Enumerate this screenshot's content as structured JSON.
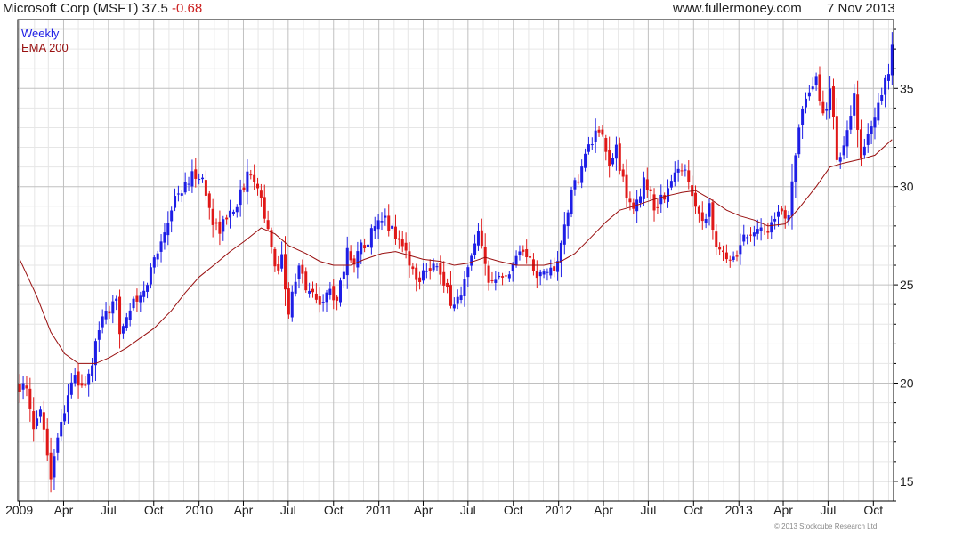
{
  "header": {
    "title": "Microsoft Corp (MSFT) 37.5",
    "change": "-0.68",
    "site": "www.fullermoney.com",
    "date": "7 Nov 2013"
  },
  "copyright": "© 2013 Stockcube Research Ltd",
  "colors": {
    "up": "#1e1ee6",
    "down": "#e01818",
    "ema": "#990f0f",
    "grid": "#c0c0c0",
    "minor_grid": "#e6e6e6"
  },
  "chart_data": {
    "type": "candlestick",
    "title": "Microsoft Corp (MSFT) 37.5 -0.68",
    "frequency": "Weekly",
    "legend": [
      {
        "name": "Weekly",
        "color": "#1e1ee6"
      },
      {
        "name": "EMA 200",
        "color": "#990f0f"
      }
    ],
    "legend_position": "top-left",
    "y_axis_position": "right",
    "ylim": [
      14,
      38.5
    ],
    "y_ticks": [
      15,
      20,
      25,
      30,
      35
    ],
    "x_range": [
      "2008-12-29",
      "2013-11-11"
    ],
    "x_ticks": [
      {
        "date": "2009-01-01",
        "label": "2009"
      },
      {
        "date": "2009-04-01",
        "label": "Apr"
      },
      {
        "date": "2009-07-01",
        "label": "Jul"
      },
      {
        "date": "2009-10-01",
        "label": "Oct"
      },
      {
        "date": "2010-01-01",
        "label": "2010"
      },
      {
        "date": "2010-04-01",
        "label": "Apr"
      },
      {
        "date": "2010-07-01",
        "label": "Jul"
      },
      {
        "date": "2010-10-01",
        "label": "Oct"
      },
      {
        "date": "2011-01-01",
        "label": "2011"
      },
      {
        "date": "2011-04-01",
        "label": "Apr"
      },
      {
        "date": "2011-07-01",
        "label": "Jul"
      },
      {
        "date": "2011-10-01",
        "label": "Oct"
      },
      {
        "date": "2012-01-01",
        "label": "2012"
      },
      {
        "date": "2012-04-01",
        "label": "Apr"
      },
      {
        "date": "2012-07-01",
        "label": "Jul"
      },
      {
        "date": "2012-10-01",
        "label": "Oct"
      },
      {
        "date": "2013-01-01",
        "label": "2013"
      },
      {
        "date": "2013-04-01",
        "label": "Apr"
      },
      {
        "date": "2013-07-01",
        "label": "Jul"
      },
      {
        "date": "2013-10-01",
        "label": "Oct"
      }
    ],
    "price_anchors": [
      [
        "2009-01-02",
        19.9
      ],
      [
        "2009-01-16",
        19.5
      ],
      [
        "2009-01-30",
        17.5
      ],
      [
        "2009-02-13",
        19.0
      ],
      [
        "2009-02-27",
        16.4
      ],
      [
        "2009-03-06",
        15.3
      ],
      [
        "2009-03-13",
        16.5
      ],
      [
        "2009-03-27",
        18.0
      ],
      [
        "2009-04-10",
        19.5
      ],
      [
        "2009-04-24",
        20.2
      ],
      [
        "2009-05-08",
        19.8
      ],
      [
        "2009-05-22",
        20.3
      ],
      [
        "2009-06-05",
        21.8
      ],
      [
        "2009-06-19",
        23.5
      ],
      [
        "2009-07-03",
        23.2
      ],
      [
        "2009-07-17",
        24.5
      ],
      [
        "2009-07-24",
        22.8
      ],
      [
        "2009-08-14",
        23.8
      ],
      [
        "2009-09-11",
        24.5
      ],
      [
        "2009-09-25",
        25.8
      ],
      [
        "2009-10-23",
        27.8
      ],
      [
        "2009-11-13",
        29.5
      ],
      [
        "2009-12-04",
        30.0
      ],
      [
        "2009-12-25",
        30.7
      ],
      [
        "2010-01-08",
        30.3
      ],
      [
        "2010-01-29",
        28.2
      ],
      [
        "2010-02-12",
        27.9
      ],
      [
        "2010-03-05",
        28.6
      ],
      [
        "2010-03-26",
        29.6
      ],
      [
        "2010-04-16",
        30.9
      ],
      [
        "2010-04-30",
        30.2
      ],
      [
        "2010-05-14",
        28.6
      ],
      [
        "2010-06-04",
        25.7
      ],
      [
        "2010-06-18",
        26.4
      ],
      [
        "2010-07-02",
        23.7
      ],
      [
        "2010-07-23",
        25.8
      ],
      [
        "2010-08-13",
        24.6
      ],
      [
        "2010-09-03",
        24.2
      ],
      [
        "2010-09-24",
        24.6
      ],
      [
        "2010-10-08",
        24.4
      ],
      [
        "2010-10-29",
        26.6
      ],
      [
        "2010-11-12",
        26.3
      ],
      [
        "2010-12-03",
        27.2
      ],
      [
        "2010-12-31",
        28.0
      ],
      [
        "2011-01-14",
        28.3
      ],
      [
        "2011-02-04",
        27.6
      ],
      [
        "2011-02-25",
        26.7
      ],
      [
        "2011-03-18",
        25.2
      ],
      [
        "2011-04-08",
        26.0
      ],
      [
        "2011-04-29",
        26.0
      ],
      [
        "2011-05-13",
        24.8
      ],
      [
        "2011-06-03",
        24.0
      ],
      [
        "2011-06-17",
        24.6
      ],
      [
        "2011-07-08",
        26.3
      ],
      [
        "2011-07-22",
        27.5
      ],
      [
        "2011-08-12",
        25.1
      ],
      [
        "2011-09-02",
        25.8
      ],
      [
        "2011-09-23",
        25.4
      ],
      [
        "2011-10-07",
        26.8
      ],
      [
        "2011-10-28",
        26.6
      ],
      [
        "2011-11-18",
        25.3
      ],
      [
        "2011-12-09",
        25.7
      ],
      [
        "2011-12-30",
        26.0
      ],
      [
        "2012-01-20",
        29.0
      ],
      [
        "2012-02-10",
        30.5
      ],
      [
        "2012-03-02",
        32.0
      ],
      [
        "2012-03-16",
        32.6
      ],
      [
        "2012-03-30",
        32.3
      ],
      [
        "2012-04-13",
        31.0
      ],
      [
        "2012-04-27",
        32.0
      ],
      [
        "2012-05-18",
        29.3
      ],
      [
        "2012-06-08",
        29.0
      ],
      [
        "2012-06-22",
        30.5
      ],
      [
        "2012-07-13",
        29.0
      ],
      [
        "2012-08-03",
        29.5
      ],
      [
        "2012-08-24",
        30.6
      ],
      [
        "2012-09-14",
        31.0
      ],
      [
        "2012-09-28",
        29.8
      ],
      [
        "2012-10-19",
        28.2
      ],
      [
        "2012-11-02",
        29.2
      ],
      [
        "2012-11-16",
        26.7
      ],
      [
        "2012-12-07",
        26.5
      ],
      [
        "2012-12-28",
        26.6
      ],
      [
        "2013-01-11",
        27.5
      ],
      [
        "2013-02-01",
        27.9
      ],
      [
        "2013-02-22",
        27.8
      ],
      [
        "2013-03-15",
        28.2
      ],
      [
        "2013-03-29",
        28.6
      ],
      [
        "2013-04-12",
        28.8
      ],
      [
        "2013-04-26",
        31.9
      ],
      [
        "2013-05-10",
        33.7
      ],
      [
        "2013-05-24",
        34.6
      ],
      [
        "2013-06-07",
        35.4
      ],
      [
        "2013-06-21",
        33.6
      ],
      [
        "2013-07-05",
        34.9
      ],
      [
        "2013-07-19",
        31.6
      ],
      [
        "2013-08-02",
        31.9
      ],
      [
        "2013-08-23",
        34.4
      ],
      [
        "2013-09-06",
        31.2
      ],
      [
        "2013-09-20",
        32.8
      ],
      [
        "2013-10-04",
        33.5
      ],
      [
        "2013-10-25",
        35.5
      ],
      [
        "2013-11-01",
        35.5
      ],
      [
        "2013-11-08",
        37.5
      ]
    ],
    "ema_200": [
      [
        "2009-01-02",
        26.3
      ],
      [
        "2009-02-06",
        24.4
      ],
      [
        "2009-03-06",
        22.6
      ],
      [
        "2009-04-03",
        21.5
      ],
      [
        "2009-05-01",
        21.0
      ],
      [
        "2009-06-05",
        21.0
      ],
      [
        "2009-07-03",
        21.3
      ],
      [
        "2009-08-07",
        21.8
      ],
      [
        "2009-09-04",
        22.3
      ],
      [
        "2009-10-02",
        22.8
      ],
      [
        "2009-11-06",
        23.7
      ],
      [
        "2009-12-04",
        24.6
      ],
      [
        "2010-01-01",
        25.4
      ],
      [
        "2010-02-05",
        26.1
      ],
      [
        "2010-03-05",
        26.7
      ],
      [
        "2010-04-02",
        27.2
      ],
      [
        "2010-05-07",
        27.9
      ],
      [
        "2010-06-04",
        27.6
      ],
      [
        "2010-07-02",
        27.0
      ],
      [
        "2010-08-06",
        26.6
      ],
      [
        "2010-09-03",
        26.2
      ],
      [
        "2010-10-01",
        26.0
      ],
      [
        "2010-11-05",
        26.0
      ],
      [
        "2010-12-03",
        26.3
      ],
      [
        "2011-01-07",
        26.6
      ],
      [
        "2011-02-04",
        26.7
      ],
      [
        "2011-03-04",
        26.5
      ],
      [
        "2011-04-01",
        26.3
      ],
      [
        "2011-05-06",
        26.2
      ],
      [
        "2011-06-03",
        26.0
      ],
      [
        "2011-07-01",
        26.1
      ],
      [
        "2011-08-05",
        26.4
      ],
      [
        "2011-09-02",
        26.2
      ],
      [
        "2011-10-07",
        26.0
      ],
      [
        "2011-11-04",
        26.0
      ],
      [
        "2011-12-02",
        26.0
      ],
      [
        "2012-01-06",
        26.2
      ],
      [
        "2012-02-03",
        26.6
      ],
      [
        "2012-03-02",
        27.3
      ],
      [
        "2012-04-06",
        28.2
      ],
      [
        "2012-05-04",
        28.8
      ],
      [
        "2012-06-01",
        29.0
      ],
      [
        "2012-07-06",
        29.3
      ],
      [
        "2012-08-03",
        29.5
      ],
      [
        "2012-09-07",
        29.7
      ],
      [
        "2012-10-05",
        29.8
      ],
      [
        "2012-11-02",
        29.4
      ],
      [
        "2012-12-07",
        28.8
      ],
      [
        "2013-01-04",
        28.5
      ],
      [
        "2013-02-01",
        28.3
      ],
      [
        "2013-03-01",
        28.0
      ],
      [
        "2013-04-05",
        28.1
      ],
      [
        "2013-05-03",
        28.9
      ],
      [
        "2013-06-07",
        30.0
      ],
      [
        "2013-07-05",
        31.0
      ],
      [
        "2013-08-02",
        31.2
      ],
      [
        "2013-09-06",
        31.4
      ],
      [
        "2013-10-04",
        31.6
      ],
      [
        "2013-11-08",
        32.4
      ]
    ]
  }
}
